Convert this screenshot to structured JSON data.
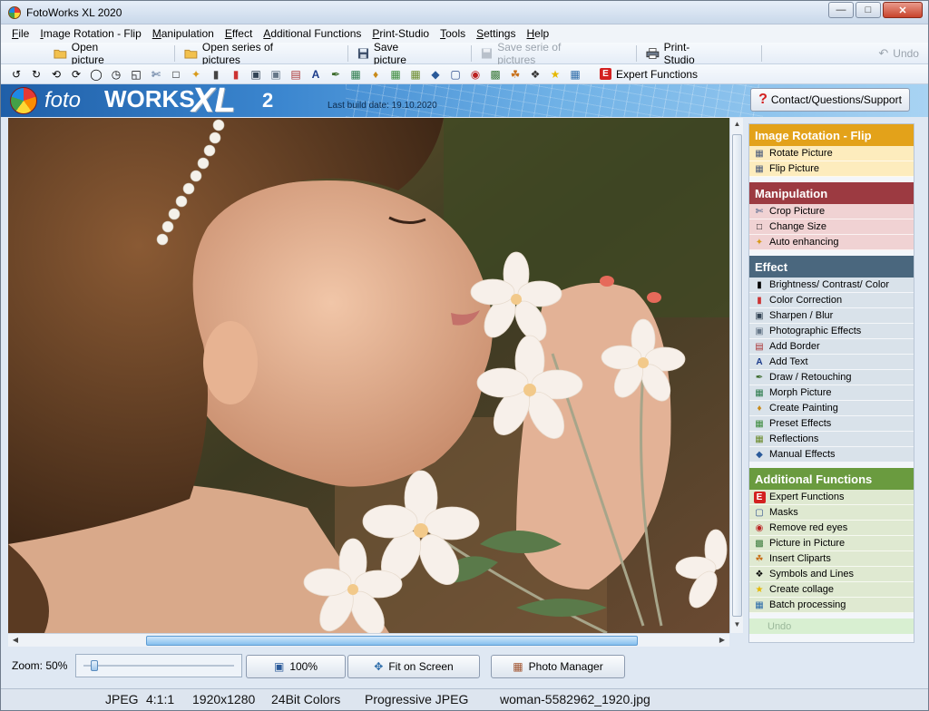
{
  "window": {
    "title": "FotoWorks XL 2020"
  },
  "menu": [
    {
      "label": "File",
      "u": "F",
      "rest": "ile"
    },
    {
      "label": "Image Rotation - Flip",
      "u": "I",
      "rest": "mage Rotation - Flip"
    },
    {
      "label": "Manipulation",
      "u": "M",
      "rest": "anipulation"
    },
    {
      "label": "Effect",
      "u": "E",
      "rest": "ffect"
    },
    {
      "label": "Additional Functions",
      "u": "A",
      "rest": "dditional Functions"
    },
    {
      "label": "Print-Studio",
      "u": "P",
      "rest": "rint-Studio"
    },
    {
      "label": "Tools",
      "u": "T",
      "rest": "ools"
    },
    {
      "label": "Settings",
      "u": "S",
      "rest": "ettings"
    },
    {
      "label": "Help",
      "u": "H",
      "rest": "elp"
    }
  ],
  "toolbar": {
    "open_picture": "Open picture",
    "open_series": "Open series of pictures",
    "save_picture": "Save picture",
    "save_serie": "Save serie of pictures",
    "print_studio": "Print-Studio",
    "undo": "Undo",
    "expert_functions": "Expert Functions",
    "expert_icon_letter": "E"
  },
  "banner": {
    "logo_foto": "foto",
    "logo_works": "WORKS",
    "logo_xl": "XL",
    "logo_version": "2",
    "build_date": "Last build date: 19.10.2020",
    "contact_button": "Contact/Questions/Support"
  },
  "panel": {
    "rotation": {
      "title": "Image Rotation - Flip",
      "items": [
        "Rotate Picture",
        "Flip Picture"
      ]
    },
    "manipulation": {
      "title": "Manipulation",
      "items": [
        "Crop Picture",
        "Change Size",
        "Auto enhancing"
      ]
    },
    "effect": {
      "title": "Effect",
      "items": [
        "Brightness/ Contrast/ Color",
        "Color Correction",
        "Sharpen / Blur",
        "Photographic Effects",
        "Add Border",
        "Add Text",
        "Draw / Retouching",
        "Morph Picture",
        "Create Painting",
        "Preset Effects",
        "Reflections",
        "Manual Effects"
      ]
    },
    "additional": {
      "title": "Additional Functions",
      "items": [
        "Expert Functions",
        "Masks",
        "Remove red eyes",
        "Picture in Picture",
        "Insert Cliparts",
        "Symbols and Lines",
        "Create collage",
        "Batch processing"
      ]
    },
    "undo": "Undo"
  },
  "bottom": {
    "zoom_label": "Zoom: 50%",
    "zoom_value": 0.05,
    "btn_100": "100%",
    "btn_fit": "Fit on Screen",
    "btn_manager": "Photo Manager"
  },
  "status": {
    "format": "JPEG",
    "ratio": "4:1:1",
    "resolution": "1920x1280",
    "colors": "24Bit Colors",
    "encoding": "Progressive JPEG",
    "filename": "woman-5582962_1920.jpg"
  },
  "colors": {
    "rotation": "#e3a21a",
    "manipulation": "#9c3a41",
    "effect": "#4a677e",
    "additional": "#6a9b3f",
    "accent": "#d32020"
  }
}
